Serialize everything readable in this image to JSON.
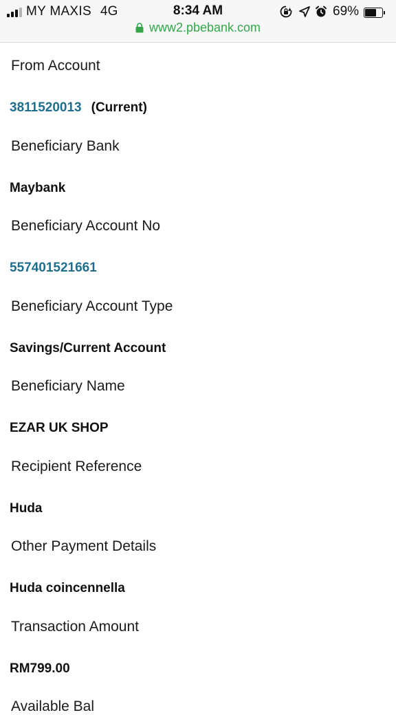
{
  "status_bar": {
    "carrier": "MY MAXIS",
    "network": "4G",
    "time": "8:34 AM",
    "battery_percent": "69%",
    "battery_level": 0.69,
    "icons": [
      "rotation-lock-icon",
      "location-arrow-icon",
      "alarm-clock-icon"
    ]
  },
  "browser": {
    "url": "www2.pbebank.com",
    "secure": true,
    "accent_color": "#33a64a"
  },
  "colors": {
    "link_value": "#1f6e8e"
  },
  "fields": {
    "from_account": {
      "label": "From Account",
      "account_number": "3811520013",
      "account_type": "(Current)"
    },
    "beneficiary_bank": {
      "label": "Beneficiary Bank",
      "value": "Maybank"
    },
    "beneficiary_account_no": {
      "label": "Beneficiary Account No",
      "value": "557401521661"
    },
    "beneficiary_account_type": {
      "label": "Beneficiary Account Type",
      "value": "Savings/Current Account"
    },
    "beneficiary_name": {
      "label": "Beneficiary Name",
      "value": "EZAR UK SHOP"
    },
    "recipient_reference": {
      "label": "Recipient Reference",
      "value": "Huda"
    },
    "other_payment_details": {
      "label": "Other Payment Details",
      "value": "Huda coincennella"
    },
    "transaction_amount": {
      "label": "Transaction Amount",
      "value": "RM799.00"
    },
    "available_balance": {
      "label": "Available Bal"
    }
  }
}
